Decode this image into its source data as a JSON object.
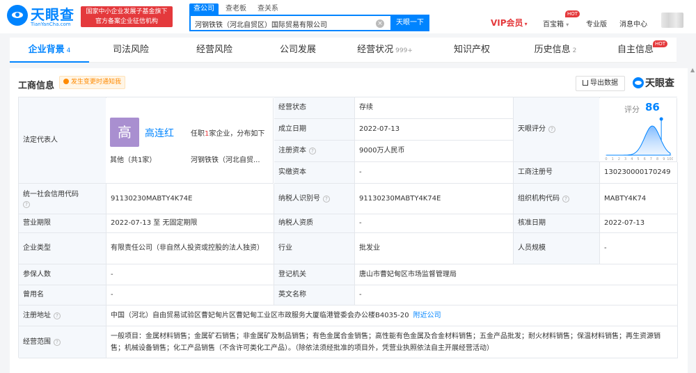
{
  "header": {
    "logo_text": "天眼查",
    "logo_sub": "TianYanCha.com",
    "slogan_line1": "国家中小企业发展子基金旗下",
    "slogan_line2": "官方备案企业征信机构",
    "search_tabs": [
      "查公司",
      "查老板",
      "查关系"
    ],
    "search_value": "河钢铁铁（河北自贸区）国际贸易有限公司",
    "search_button": "天眼一下",
    "vip": "VIP会员",
    "treasure": "百宝箱",
    "hot": "HOT",
    "professional": "专业版",
    "messages": "消息中心"
  },
  "tabs": [
    {
      "label": "企业背景",
      "count": "4"
    },
    {
      "label": "司法风险",
      "count": ""
    },
    {
      "label": "经营风险",
      "count": ""
    },
    {
      "label": "公司发展",
      "count": ""
    },
    {
      "label": "经营状况",
      "count": "999+"
    },
    {
      "label": "知识产权",
      "count": ""
    },
    {
      "label": "历史信息",
      "count": "2"
    },
    {
      "label": "自主信息",
      "count": ""
    }
  ],
  "section": {
    "title": "工商信息",
    "notice": "发生变更时通知我",
    "export": "导出数据",
    "brand": "天眼查"
  },
  "info": {
    "legal_label": "法定代表人",
    "legal_avatar": "高",
    "legal_name": "高连红",
    "legal_desc_pre": "任职",
    "legal_desc_num": "1",
    "legal_desc_post": "家企业，分布如下",
    "legal_other": "其他（共1家）",
    "legal_company": "河钢铁铁（河北自贸...",
    "status_label": "经营状态",
    "status_value": "存续",
    "est_label": "成立日期",
    "est_value": "2022-07-13",
    "reg_cap_label": "注册资本",
    "reg_cap_value": "9000万人民币",
    "paid_cap_label": "实缴资本",
    "paid_cap_value": "-",
    "score_row_label": "天眼评分",
    "score_label": "评分",
    "score_value": "86",
    "score_ticks": [
      "0",
      "1",
      "2",
      "3",
      "4",
      "5",
      "6",
      "7",
      "8",
      "9",
      "100"
    ],
    "reg_no_label": "工商注册号",
    "reg_no_value": "130230000170249",
    "credit_code_label": "统一社会信用代码",
    "credit_code_value": "91130230MABTY4K74E",
    "taxpayer_id_label": "纳税人识别号",
    "taxpayer_id_value": "91130230MABTY4K74E",
    "org_code_label": "组织机构代码",
    "org_code_value": "MABTY4K74",
    "term_label": "营业期限",
    "term_value": "2022-07-13 至 无固定期限",
    "taxpayer_qual_label": "纳税人资质",
    "taxpayer_qual_value": "-",
    "approve_label": "核准日期",
    "approve_value": "2022-07-13",
    "type_label": "企业类型",
    "type_value": "有限责任公司（非自然人投资或控股的法人独资）",
    "industry_label": "行业",
    "industry_value": "批发业",
    "staff_label": "人员规模",
    "staff_value": "-",
    "insured_label": "参保人数",
    "insured_value": "-",
    "authority_label": "登记机关",
    "authority_value": "唐山市曹妃甸区市场监督管理局",
    "former_label": "曾用名",
    "former_value": "-",
    "english_label": "英文名称",
    "english_value": "-",
    "address_label": "注册地址",
    "address_value": "中国（河北）自由贸易试验区曹妃甸片区曹妃甸工业区市政服务大厦临港管委会办公楼B4035-20",
    "address_link": "附近公司",
    "scope_label": "经营范围",
    "scope_value": "一般项目：金属材料销售；金属矿石销售；非金属矿及制品销售；有色金属合金销售；高性能有色金属及合金材料销售；五金产品批发；耐火材料销售；保温材料销售；再生资源销售；机械设备销售；化工产品销售（不含许可类化工产品）。（除依法须经批准的项目外，凭营业执照依法自主开展经营活动）"
  }
}
